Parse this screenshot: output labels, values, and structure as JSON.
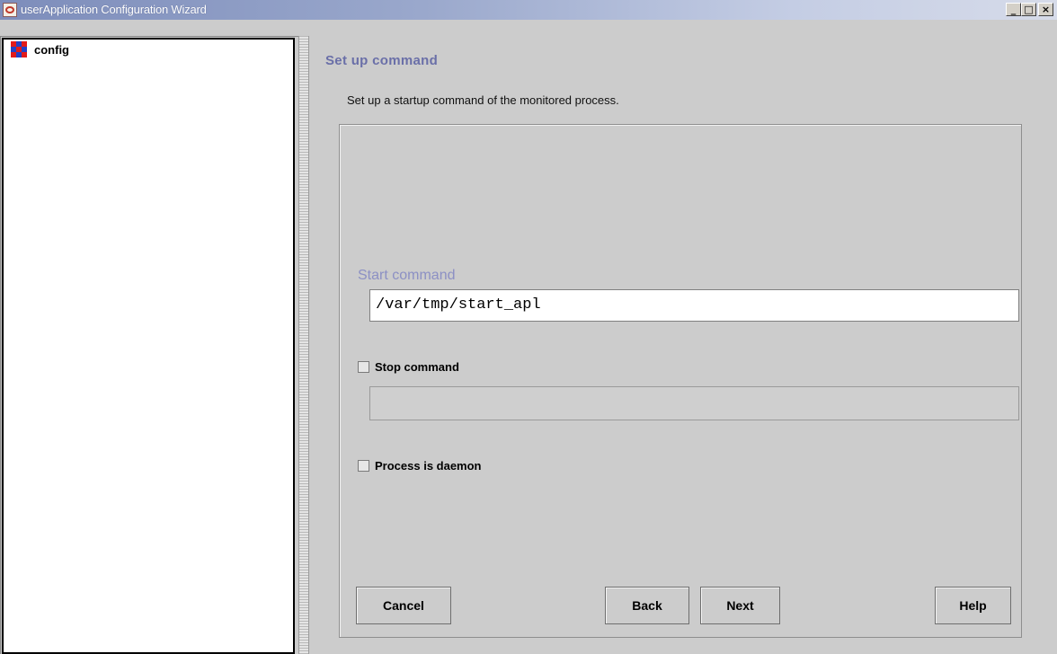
{
  "window": {
    "title": "userApplication Configuration Wizard",
    "controls": {
      "minimize": "_",
      "maximize": "□",
      "close": "×"
    }
  },
  "tree": {
    "root_label": "config"
  },
  "page": {
    "title": "Set up command",
    "description": "Set up a startup command of the monitored process."
  },
  "form": {
    "start_command_label": "Start command",
    "start_command_value": "/var/tmp/start_apl",
    "stop_command_label": "Stop command",
    "stop_command_checked": false,
    "stop_command_value": "",
    "daemon_label": "Process is daemon",
    "daemon_checked": false
  },
  "buttons": {
    "cancel": "Cancel",
    "back": "Back",
    "next": "Next",
    "help": "Help"
  },
  "icons": {
    "app": "wizard-app-icon",
    "tree_root": "config-node-icon"
  }
}
